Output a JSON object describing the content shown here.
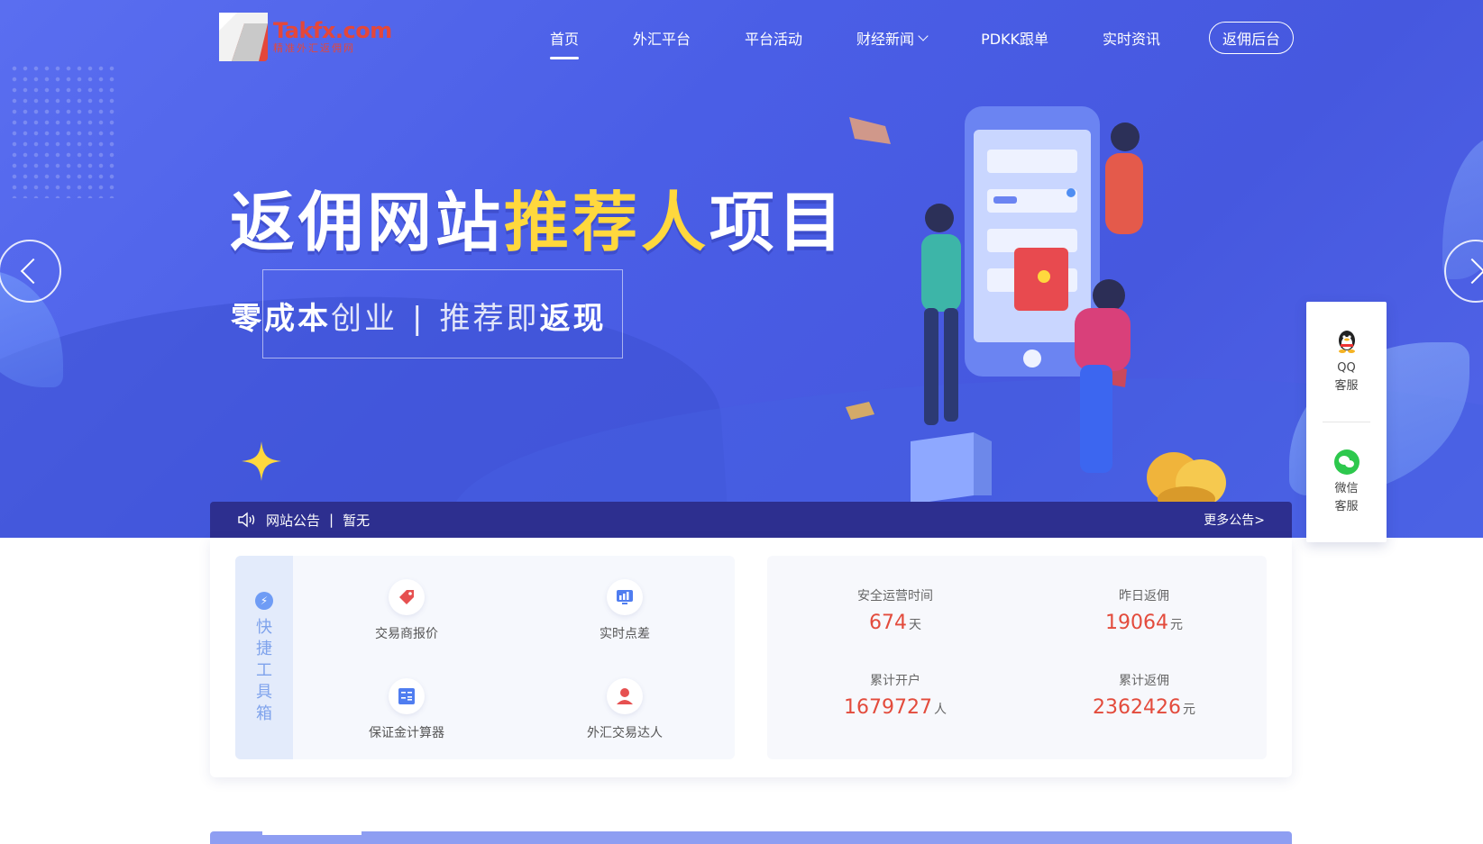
{
  "logo": {
    "name": "Takfx.com",
    "slogan": "精准外汇返佣网"
  },
  "nav": {
    "items": [
      {
        "label": "首页"
      },
      {
        "label": "外汇平台"
      },
      {
        "label": "平台活动"
      },
      {
        "label": "财经新闻"
      },
      {
        "label": "PDKK跟单"
      },
      {
        "label": "实时资讯"
      }
    ],
    "button": "返佣后台"
  },
  "banner": {
    "title_white": "返佣网站",
    "title_yellow": "推荐人",
    "title_white2": "项目",
    "sub_a_bold": "零成本",
    "sub_a_light": "创业",
    "sub_sep": "|",
    "sub_b_light": "推荐即",
    "sub_b_bold": "返现"
  },
  "notice": {
    "label": "网站公告",
    "divider": "|",
    "content": "暂无",
    "more": "更多公告>"
  },
  "toolbox": {
    "title": "快捷工具箱",
    "tools": [
      {
        "label": "交易商报价",
        "icon": "price-tag-icon"
      },
      {
        "label": "实时点差",
        "icon": "chart-monitor-icon"
      },
      {
        "label": "保证金计算器",
        "icon": "calculator-icon"
      },
      {
        "label": "外汇交易达人",
        "icon": "user-icon"
      }
    ]
  },
  "stats": [
    {
      "label": "安全运营时间",
      "value": "674",
      "unit": "天"
    },
    {
      "label": "昨日返佣",
      "value": "19064",
      "unit": "元"
    },
    {
      "label": "累计开户",
      "value": "1679727",
      "unit": "人"
    },
    {
      "label": "累计返佣",
      "value": "2362426",
      "unit": "元"
    }
  ],
  "service": [
    {
      "line1": "QQ",
      "line2": "客服",
      "icon": "qq-penguin-icon"
    },
    {
      "line1": "微信",
      "line2": "客服",
      "icon": "wechat-icon"
    }
  ],
  "colors": {
    "primary": "#4a5ee6",
    "accent": "#ffd83d",
    "stat_value": "#e34b3c",
    "notice_bg": "#2d2f8f"
  }
}
